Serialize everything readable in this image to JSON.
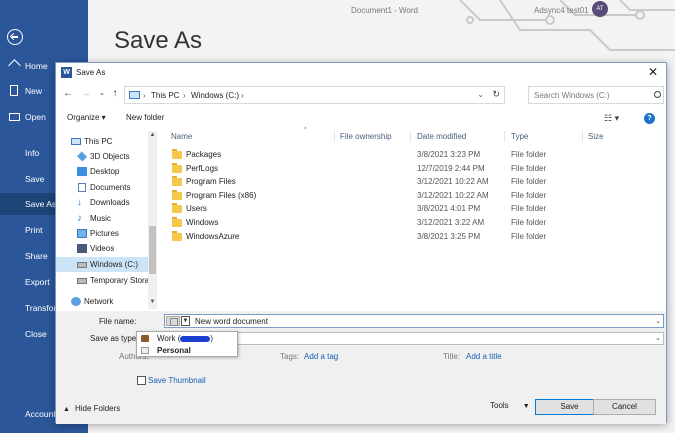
{
  "backstage": {
    "title": "Save As",
    "doc_title": "Document1 - Word",
    "user_name": "Adsync4 test01",
    "avatar_initials": "AT",
    "nav": [
      "Home",
      "New",
      "Open",
      "Info",
      "Save",
      "Save As",
      "Print",
      "Share",
      "Export",
      "Transform",
      "Close",
      "Account"
    ]
  },
  "dialog": {
    "title": "Save As",
    "close_label": "✕",
    "address": {
      "segments": [
        "This PC",
        "Windows (C:)"
      ]
    },
    "search_placeholder": "Search Windows (C:)",
    "toolbar": {
      "organize": "Organize ▾",
      "new_folder": "New folder",
      "help": "?"
    },
    "nav_pane": [
      "This PC",
      "3D Objects",
      "Desktop",
      "Documents",
      "Downloads",
      "Music",
      "Pictures",
      "Videos",
      "Windows (C:)",
      "Temporary Stora",
      "Network"
    ],
    "columns": [
      "Name",
      "File ownership",
      "Date modified",
      "Type",
      "Size"
    ],
    "files": [
      {
        "name": "Packages",
        "date": "3/8/2021 3:23 PM",
        "type": "File folder"
      },
      {
        "name": "PerfLogs",
        "date": "12/7/2019 2:44 PM",
        "type": "File folder"
      },
      {
        "name": "Program Files",
        "date": "3/12/2021 10:22 AM",
        "type": "File folder"
      },
      {
        "name": "Program Files (x86)",
        "date": "3/12/2021 10:22 AM",
        "type": "File folder"
      },
      {
        "name": "Users",
        "date": "3/8/2021 4:01 PM",
        "type": "File folder"
      },
      {
        "name": "Windows",
        "date": "3/12/2021 3:22 AM",
        "type": "File folder"
      },
      {
        "name": "WindowsAzure",
        "date": "3/8/2021 3:25 PM",
        "type": "File folder"
      }
    ],
    "file_name_label": "File name:",
    "file_name_value": "New word document",
    "save_as_type_label": "Save as type:",
    "authors_label": "Authors:",
    "tags_label": "Tags:",
    "tags_link": "Add a tag",
    "title_label": "Title:",
    "title_link": "Add a title",
    "save_thumbnail": "Save Thumbnail",
    "hide_folders": "Hide Folders",
    "tools": "Tools",
    "save_button": "Save",
    "cancel_button": "Cancel",
    "popup": {
      "work": "Work (",
      "work_suffix": ")",
      "personal": "Personal"
    }
  },
  "colors": {
    "word_blue": "#2b579a",
    "selected": "#cce4f7",
    "link": "#1a5fb4"
  }
}
